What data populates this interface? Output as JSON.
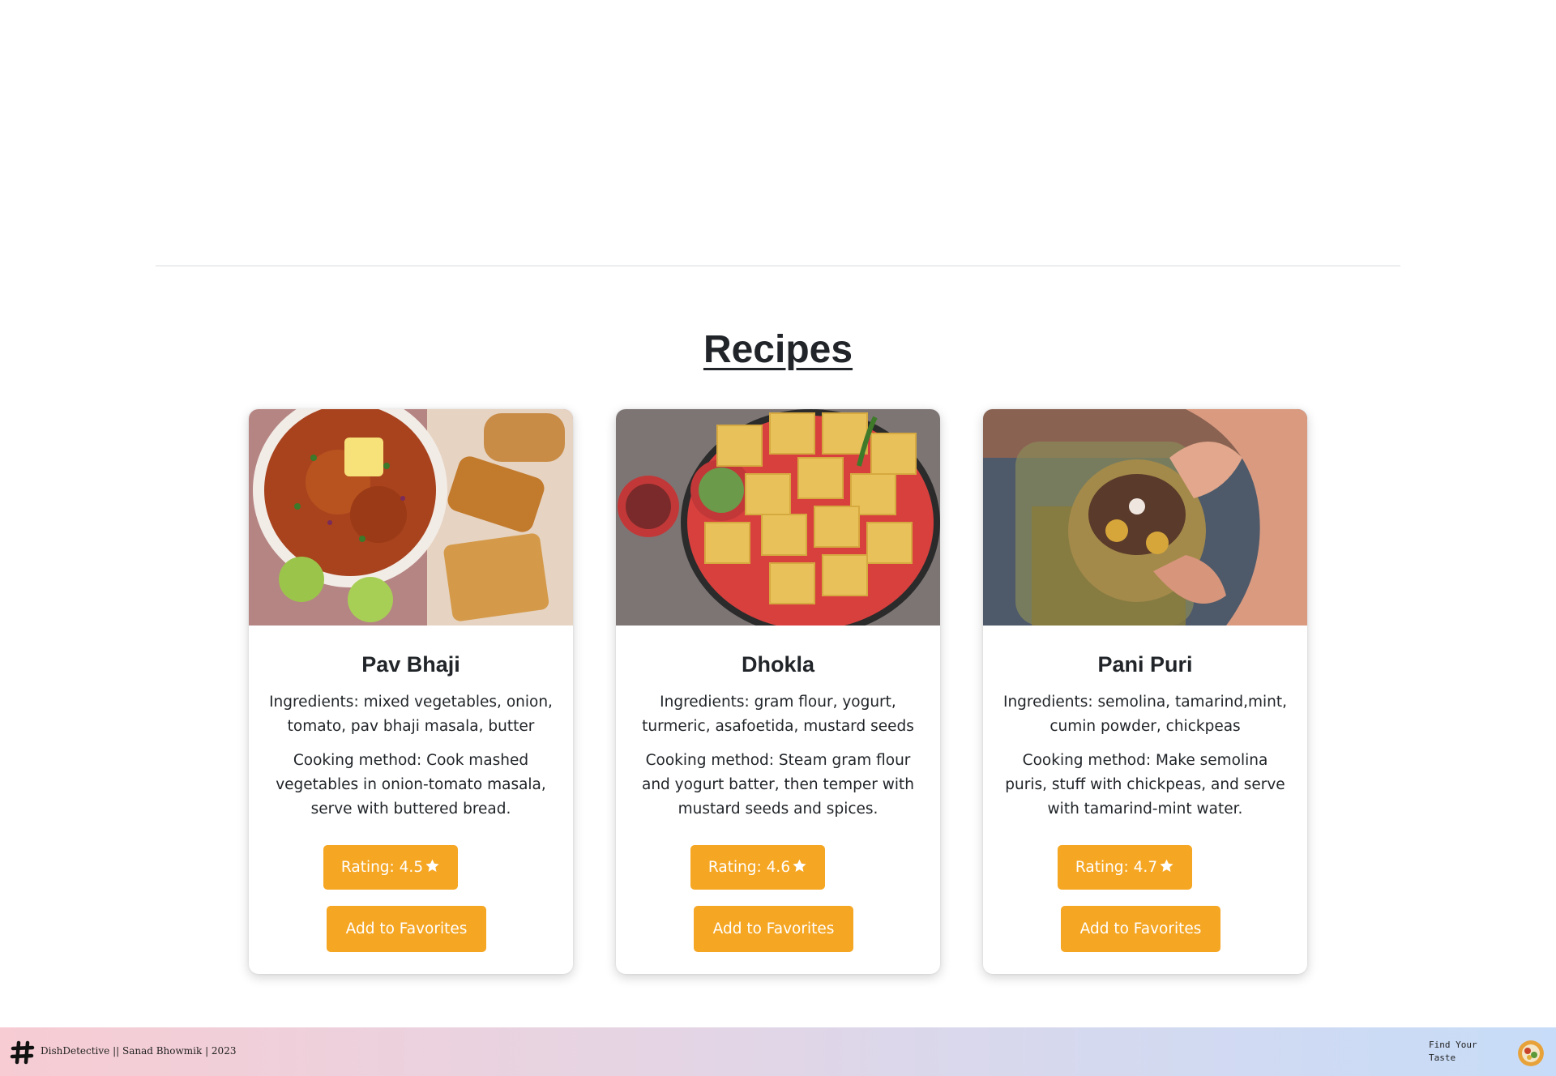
{
  "section": {
    "title": "Recipes"
  },
  "recipes": [
    {
      "title": "Pav Bhaji",
      "image": "pav-bhaji-photo",
      "ingredients": "Ingredients: mixed vegetables, onion, tomato, pav bhaji masala, butter",
      "method": "Cooking method: Cook mashed vegetables in onion-tomato masala, serve with buttered bread.",
      "rating_label": "Rating: 4.5",
      "rating": 4.5,
      "favorite_label": "Add to Favorites"
    },
    {
      "title": "Dhokla",
      "image": "dhokla-photo",
      "ingredients": "Ingredients: gram flour, yogurt, turmeric, asafoetida, mustard seeds",
      "method": "Cooking method: Steam gram flour and yogurt batter, then temper with mustard seeds and spices.",
      "rating_label": "Rating: 4.6",
      "rating": 4.6,
      "favorite_label": "Add to Favorites"
    },
    {
      "title": "Pani Puri",
      "image": "pani-puri-photo",
      "ingredients": "Ingredients: semolina, tamarind,mint, cumin powder, chickpeas",
      "method": "Cooking method: Make semolina puris, stuff with chickpeas, and serve with tamarind-mint water.",
      "rating_label": "Rating: 4.7",
      "rating": 4.7,
      "favorite_label": "Add to Favorites"
    }
  ],
  "footer": {
    "logo_icon": "hash-icon",
    "text": "DishDetective || Sanad Bhowmik | 2023",
    "tagline": "Find Your Taste",
    "avatar": "food-plate-avatar"
  },
  "colors": {
    "accent": "#f5a623",
    "text": "#212529",
    "footer_gradient_start": "#f7ccd3",
    "footer_gradient_end": "#c7dcf8"
  }
}
